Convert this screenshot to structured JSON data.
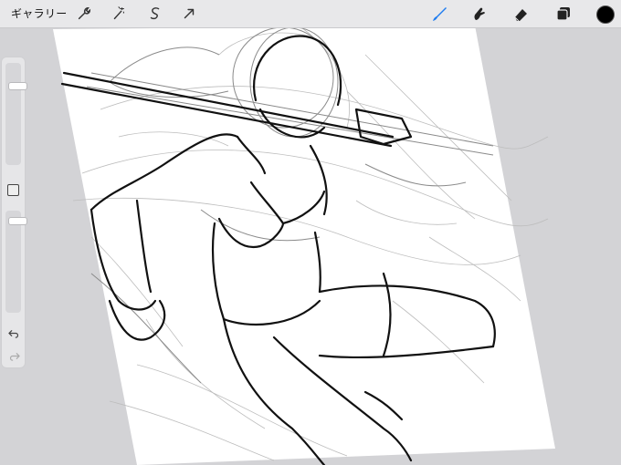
{
  "toolbar": {
    "gallery_label": "ギャラリー",
    "left_tools": [
      "wrench-icon",
      "magic-wand-icon",
      "selection-icon",
      "transform-arrow-icon"
    ],
    "right_tools": [
      "brush-icon",
      "smudge-icon",
      "eraser-icon",
      "layers-icon"
    ],
    "active_tool": "brush-icon",
    "accent_color": "#1e7cf0",
    "current_color": "#000000"
  },
  "sidebar": {
    "brush_size_level": 0.82,
    "opacity_level": 0.95,
    "modify_label": "",
    "undo": "undo-icon",
    "redo": "redo-icon"
  }
}
